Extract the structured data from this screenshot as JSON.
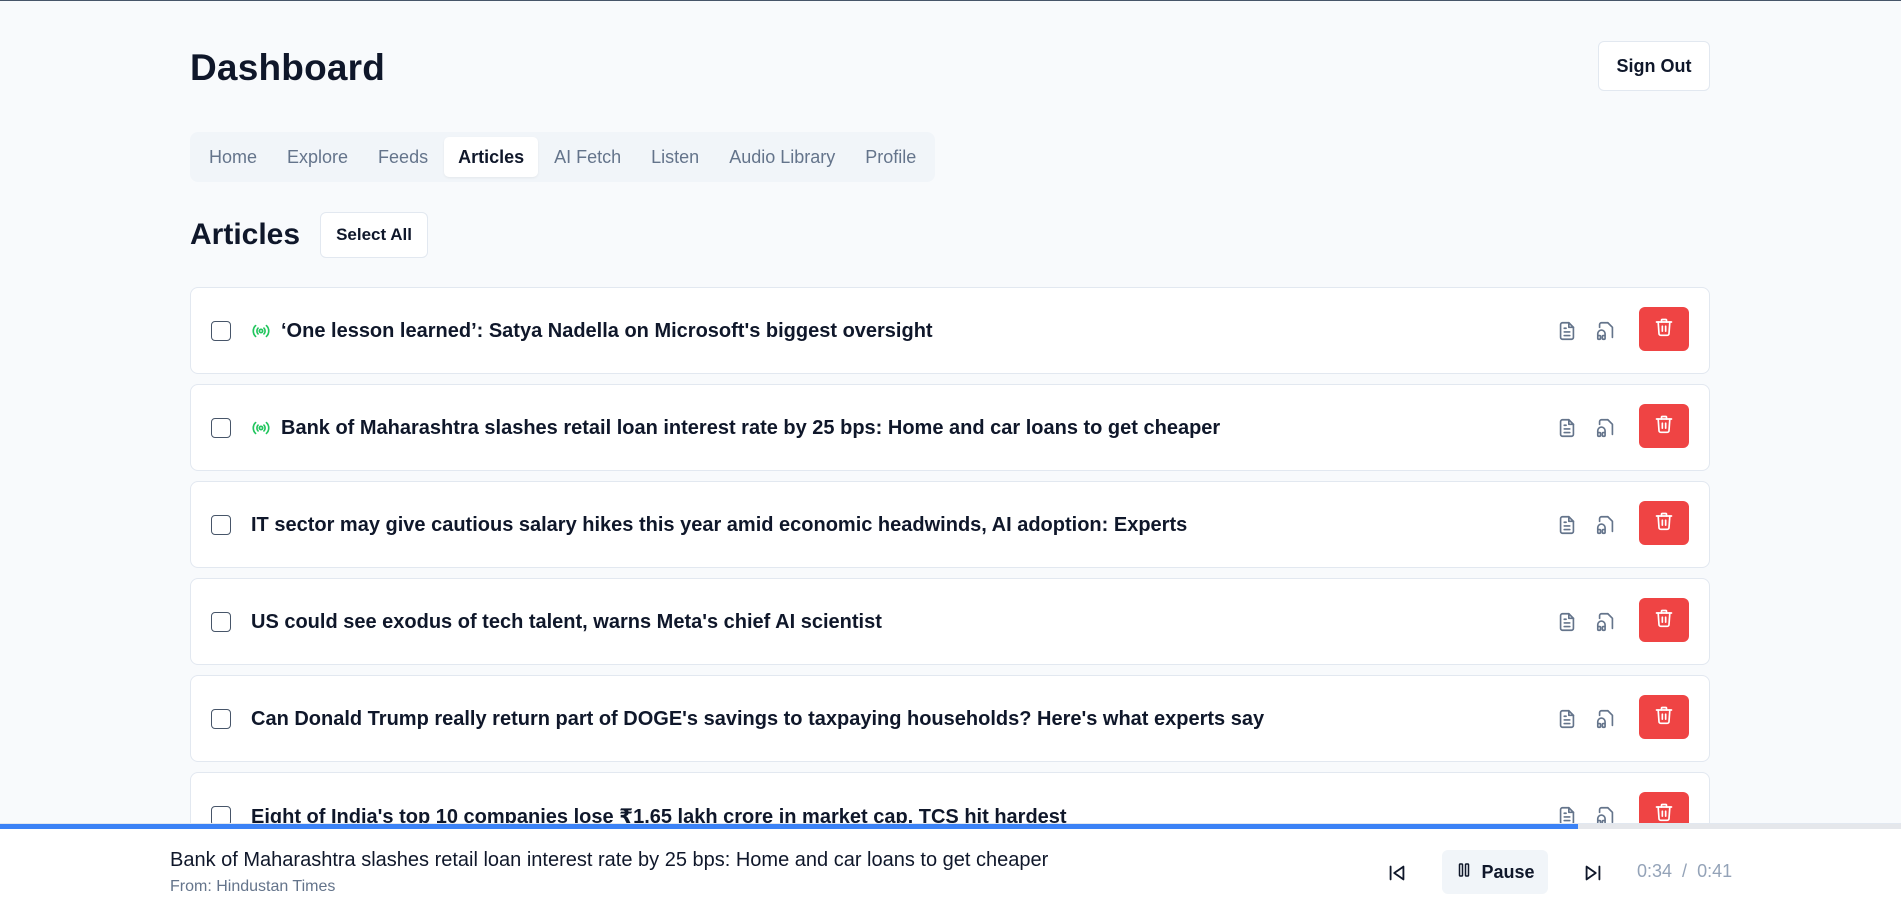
{
  "header": {
    "title": "Dashboard",
    "sign_out_label": "Sign Out"
  },
  "tabs": [
    {
      "label": "Home",
      "active": false
    },
    {
      "label": "Explore",
      "active": false
    },
    {
      "label": "Feeds",
      "active": false
    },
    {
      "label": "Articles",
      "active": true
    },
    {
      "label": "AI Fetch",
      "active": false
    },
    {
      "label": "Listen",
      "active": false
    },
    {
      "label": "Audio Library",
      "active": false
    },
    {
      "label": "Profile",
      "active": false
    }
  ],
  "articles_section": {
    "title": "Articles",
    "select_all_label": "Select All",
    "items": [
      {
        "title": "‘One lesson learned’: Satya Nadella on Microsoft's biggest oversight",
        "has_audio": true
      },
      {
        "title": "Bank of Maharashtra slashes retail loan interest rate by 25 bps: Home and car loans to get cheaper",
        "has_audio": true
      },
      {
        "title": "IT sector may give cautious salary hikes this year amid economic headwinds, AI adoption: Experts",
        "has_audio": false
      },
      {
        "title": "US could see exodus of tech talent, warns Meta's chief AI scientist",
        "has_audio": false
      },
      {
        "title": "Can Donald Trump really return part of DOGE's savings to taxpaying households? Here's what experts say",
        "has_audio": false
      },
      {
        "title": "Eight of India's top 10 companies lose ₹1.65 lakh crore in market cap, TCS hit hardest",
        "has_audio": false
      }
    ]
  },
  "player": {
    "now_playing_title": "Bank of Maharashtra slashes retail loan interest rate by 25 bps: Home and car loans to get cheaper",
    "source": "From: Hindustan Times",
    "pause_label": "Pause",
    "current_time": "0:34",
    "separator": "/",
    "total_time": "0:41",
    "progress_fraction": 0.83
  },
  "colors": {
    "accent": "#3b82f6",
    "danger": "#ef4444",
    "live_indicator": "#22c55e"
  }
}
